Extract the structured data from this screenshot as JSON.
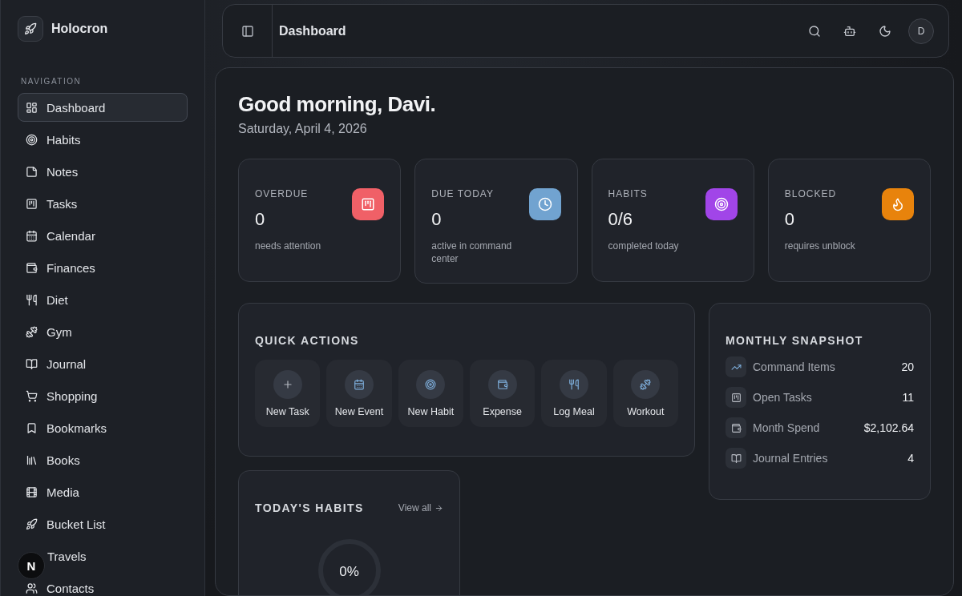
{
  "sidebar": {
    "brand": "Holocron",
    "section": "NAVIGATION",
    "items": [
      {
        "label": "Dashboard",
        "selected": true
      },
      {
        "label": "Habits",
        "selected": false
      },
      {
        "label": "Notes",
        "selected": false
      },
      {
        "label": "Tasks",
        "selected": false
      },
      {
        "label": "Calendar",
        "selected": false
      },
      {
        "label": "Finances",
        "selected": false
      },
      {
        "label": "Diet",
        "selected": false
      },
      {
        "label": "Gym",
        "selected": false
      },
      {
        "label": "Journal",
        "selected": false
      },
      {
        "label": "Shopping",
        "selected": false
      },
      {
        "label": "Bookmarks",
        "selected": false
      },
      {
        "label": "Books",
        "selected": false
      },
      {
        "label": "Media",
        "selected": false
      },
      {
        "label": "Bucket List",
        "selected": false
      },
      {
        "label": "Travels",
        "selected": false
      },
      {
        "label": "Contacts",
        "selected": false
      }
    ],
    "dev_badge": "N"
  },
  "topbar": {
    "title": "Dashboard",
    "avatar": "D"
  },
  "greeting": {
    "title": "Good morning, Davi.",
    "date": "Saturday, April 4, 2026"
  },
  "stats": [
    {
      "label": "OVERDUE",
      "value": "0",
      "caption": "needs attention",
      "color": "#f06067"
    },
    {
      "label": "DUE TODAY",
      "value": "0",
      "caption": "active in command center",
      "color": "#71a3d0"
    },
    {
      "label": "HABITS",
      "value": "0/6",
      "caption": "completed today",
      "color": "#a145e8"
    },
    {
      "label": "BLOCKED",
      "value": "0",
      "caption": "requires unblock",
      "color": "#e8830c"
    }
  ],
  "quick_actions": {
    "title": "QUICK ACTIONS",
    "actions": [
      "New Task",
      "New Event",
      "New Habit",
      "Expense",
      "Log Meal",
      "Workout"
    ]
  },
  "snapshot": {
    "title": "MONTHLY SNAPSHOT",
    "rows": [
      {
        "label": "Command Items",
        "value": "20"
      },
      {
        "label": "Open Tasks",
        "value": "11"
      },
      {
        "label": "Month Spend",
        "value": "$2,102.64"
      },
      {
        "label": "Journal Entries",
        "value": "4"
      }
    ]
  },
  "habits": {
    "title": "TODAY'S HABITS",
    "link": "View all",
    "progress": {
      "level": 0,
      "reading": "0%"
    }
  }
}
